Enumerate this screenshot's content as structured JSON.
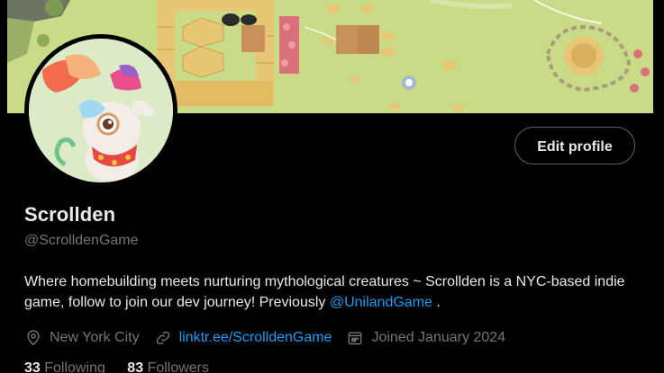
{
  "profile": {
    "display_name": "Scrollden",
    "handle": "@ScrolldenGame",
    "edit_button_label": "Edit profile",
    "bio_text": "Where homebuilding meets nurturing mythological creatures ~ Scrollden is a NYC-based indie game, follow to join our dev journey! Previously ",
    "bio_mention": "@UnilandGame",
    "bio_trailing": " .",
    "location": "New York City",
    "website": "linktr.ee/ScrolldenGame",
    "joined": "Joined January 2024",
    "following_count": "33",
    "following_label": "Following",
    "followers_count": "83",
    "followers_label": "Followers"
  },
  "colors": {
    "background": "#000000",
    "text_primary": "#e7e9ea",
    "text_secondary": "#71767b",
    "link": "#1d9bf0",
    "button_border": "#536471"
  },
  "icons": {
    "location": "location-pin-icon",
    "link": "link-icon",
    "calendar": "calendar-icon"
  }
}
